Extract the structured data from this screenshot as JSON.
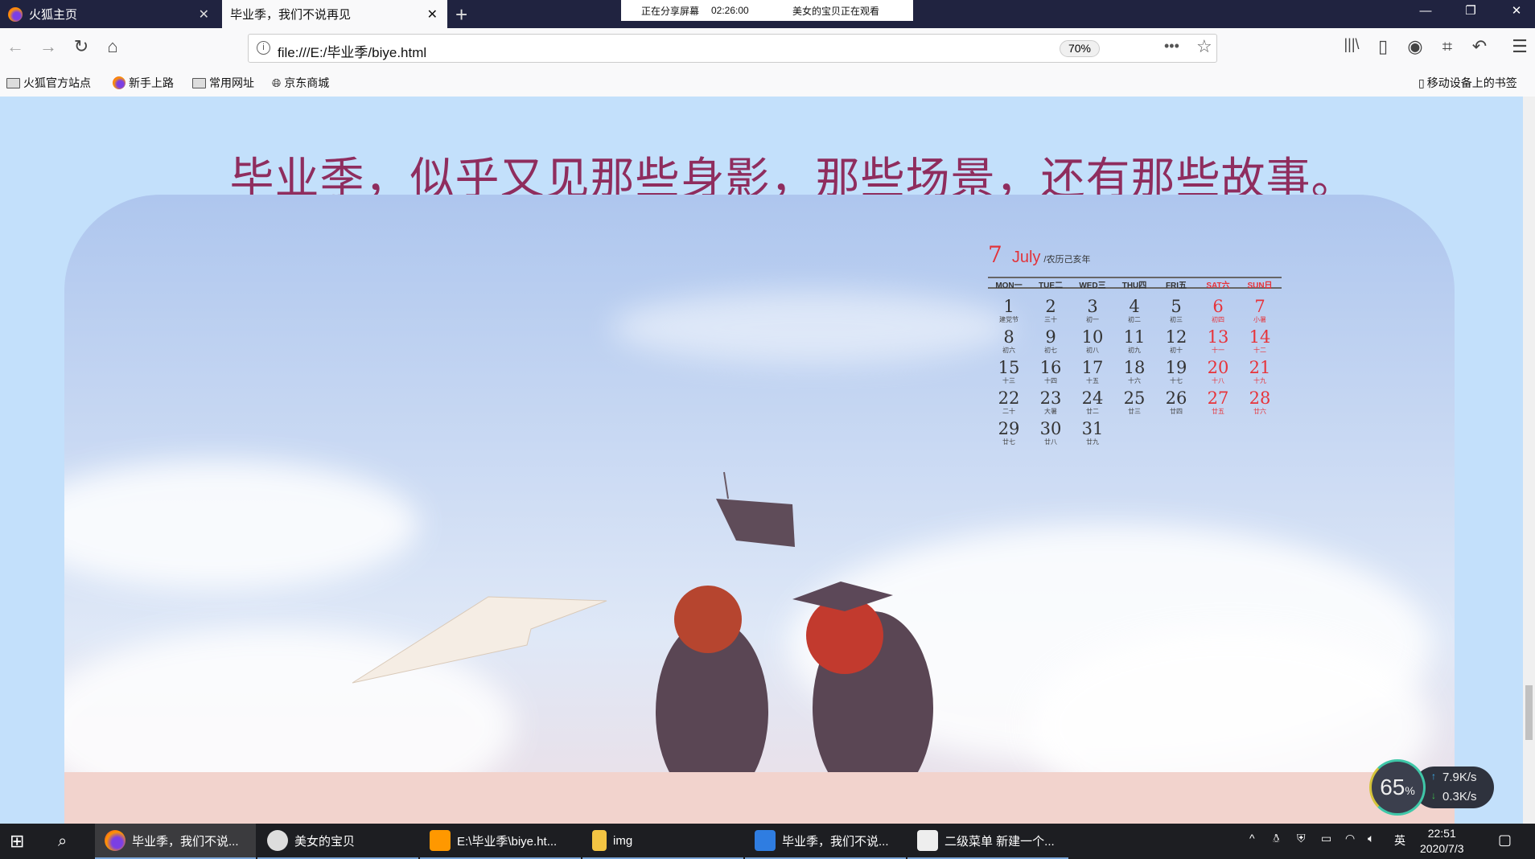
{
  "tabs": [
    {
      "label": "火狐主页",
      "active": false
    },
    {
      "label": "毕业季，我们不说再见",
      "active": true
    }
  ],
  "share_banner": {
    "status": "正在分享屏幕",
    "timer": "02:26:00",
    "viewer": "美女的宝贝正在观看"
  },
  "url": "file:///E:/毕业季/biye.html",
  "zoom": "70%",
  "bookmarks": [
    "火狐官方站点",
    "新手上路",
    "常用网址",
    "京东商城"
  ],
  "mobile_bookmarks": "移动设备上的书签",
  "page": {
    "heading": "毕业季，似乎又见那些身影，那些场景，还有那些故事。"
  },
  "calendar": {
    "month_num": "7",
    "month_name": "July",
    "lunar_year": "/农历己亥年",
    "weekdays": [
      "MON一",
      "TUE二",
      "WED三",
      "THU四",
      "FRI五",
      "SAT六",
      "SUN日"
    ],
    "days": [
      [
        "1",
        "建党节"
      ],
      [
        "2",
        "三十"
      ],
      [
        "3",
        "初一"
      ],
      [
        "4",
        "初二"
      ],
      [
        "5",
        "初三"
      ],
      [
        "6",
        "初四"
      ],
      [
        "7",
        "小暑"
      ],
      [
        "8",
        "初六"
      ],
      [
        "9",
        "初七"
      ],
      [
        "10",
        "初八"
      ],
      [
        "11",
        "初九"
      ],
      [
        "12",
        "初十"
      ],
      [
        "13",
        "十一"
      ],
      [
        "14",
        "十二"
      ],
      [
        "15",
        "十三"
      ],
      [
        "16",
        "十四"
      ],
      [
        "17",
        "十五"
      ],
      [
        "18",
        "十六"
      ],
      [
        "19",
        "十七"
      ],
      [
        "20",
        "十八"
      ],
      [
        "21",
        "十九"
      ],
      [
        "22",
        "二十"
      ],
      [
        "23",
        "大暑"
      ],
      [
        "24",
        "廿二"
      ],
      [
        "25",
        "廿三"
      ],
      [
        "26",
        "廿四"
      ],
      [
        "27",
        "廿五"
      ],
      [
        "28",
        "廿六"
      ],
      [
        "29",
        "廿七"
      ],
      [
        "30",
        "廿八"
      ],
      [
        "31",
        "廿九"
      ]
    ]
  },
  "speed": {
    "percent": "65",
    "percent_sign": "%",
    "up": "7.9K/s",
    "down": "0.3K/s"
  },
  "taskbar": {
    "items": [
      "毕业季，我们不说...",
      "美女的宝贝",
      "E:\\毕业季\\biye.ht...",
      "img",
      "毕业季，我们不说...",
      "二级菜单  新建一个..."
    ],
    "ime": "英",
    "time": "22:51",
    "date": "2020/7/3"
  }
}
